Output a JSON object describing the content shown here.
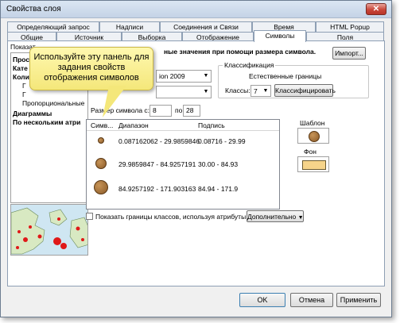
{
  "window": {
    "title": "Свойства слоя"
  },
  "tabs_back": [
    "Определяющий запрос",
    "Надписи",
    "Соединения и Связи",
    "Время",
    "HTML Popup"
  ],
  "tabs_front": [
    "Общие",
    "Источник",
    "Выборка",
    "Отображение",
    "Символы",
    "Поля"
  ],
  "active_tab": "Символы",
  "show_label": "Показат",
  "tree": {
    "items": [
      "Прос",
      "Кате",
      "Коли",
      "Г",
      "Г",
      "Пропорциональные",
      "Диаграммы",
      "По нескольким атри"
    ]
  },
  "heading": "ные значения при помощи размера символа.",
  "import_button": "Импорт...",
  "field_combo": "ion 2009",
  "classification": {
    "title": "Классификация",
    "method": "Естественные границы",
    "classes_label": "Классы:",
    "classes_value": "7",
    "classify_button": "Классифицировать"
  },
  "symbol_size": {
    "label": "Размер символа с:",
    "from": "8",
    "to_label": "по:",
    "to": "28"
  },
  "list": {
    "headers": [
      "Симв...",
      "Диапазон",
      "Подпись"
    ],
    "rows": [
      {
        "range": "0.087162062 - 29.9859846",
        "label": "0.08716 - 29.99"
      },
      {
        "range": "29.9859847 - 84.9257191",
        "label": "30.00 - 84.93"
      },
      {
        "range": "84.9257192 - 171.903163",
        "label": "84.94 - 171.9"
      }
    ]
  },
  "template_label": "Шаблон",
  "background_label": "Фон",
  "show_class_bounds": "Показать границы классов, используя атрибуты",
  "advanced_button": "Дополнительно",
  "callout_text": "Используйте эту панель для задания свойств отображения символов",
  "buttons": {
    "ok": "OK",
    "cancel": "Отмена",
    "apply": "Применить"
  },
  "colors": {
    "symbol": "#a87a45",
    "background_fill": "#f6d48a"
  }
}
